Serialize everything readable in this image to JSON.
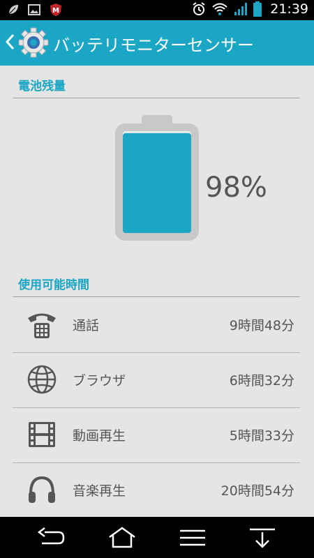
{
  "status": {
    "time": "21:39"
  },
  "appbar": {
    "title": "バッテリモニターセンサー"
  },
  "battery": {
    "section_title": "電池残量",
    "level": 0.98,
    "percent_label": "98%"
  },
  "usage": {
    "section_title": "使用可能時間",
    "items": [
      {
        "icon": "phone-icon",
        "label": "通話",
        "value": "9時間48分"
      },
      {
        "icon": "globe-icon",
        "label": "ブラウザ",
        "value": "6時間32分"
      },
      {
        "icon": "film-icon",
        "label": "動画再生",
        "value": "5時間33分"
      },
      {
        "icon": "headphones-icon",
        "label": "音楽再生",
        "value": "20時間54分"
      }
    ]
  },
  "colors": {
    "accent": "#1aa6c4",
    "battery_fill": "#1aa6c4",
    "battery_shell": "#c8c8c8"
  }
}
